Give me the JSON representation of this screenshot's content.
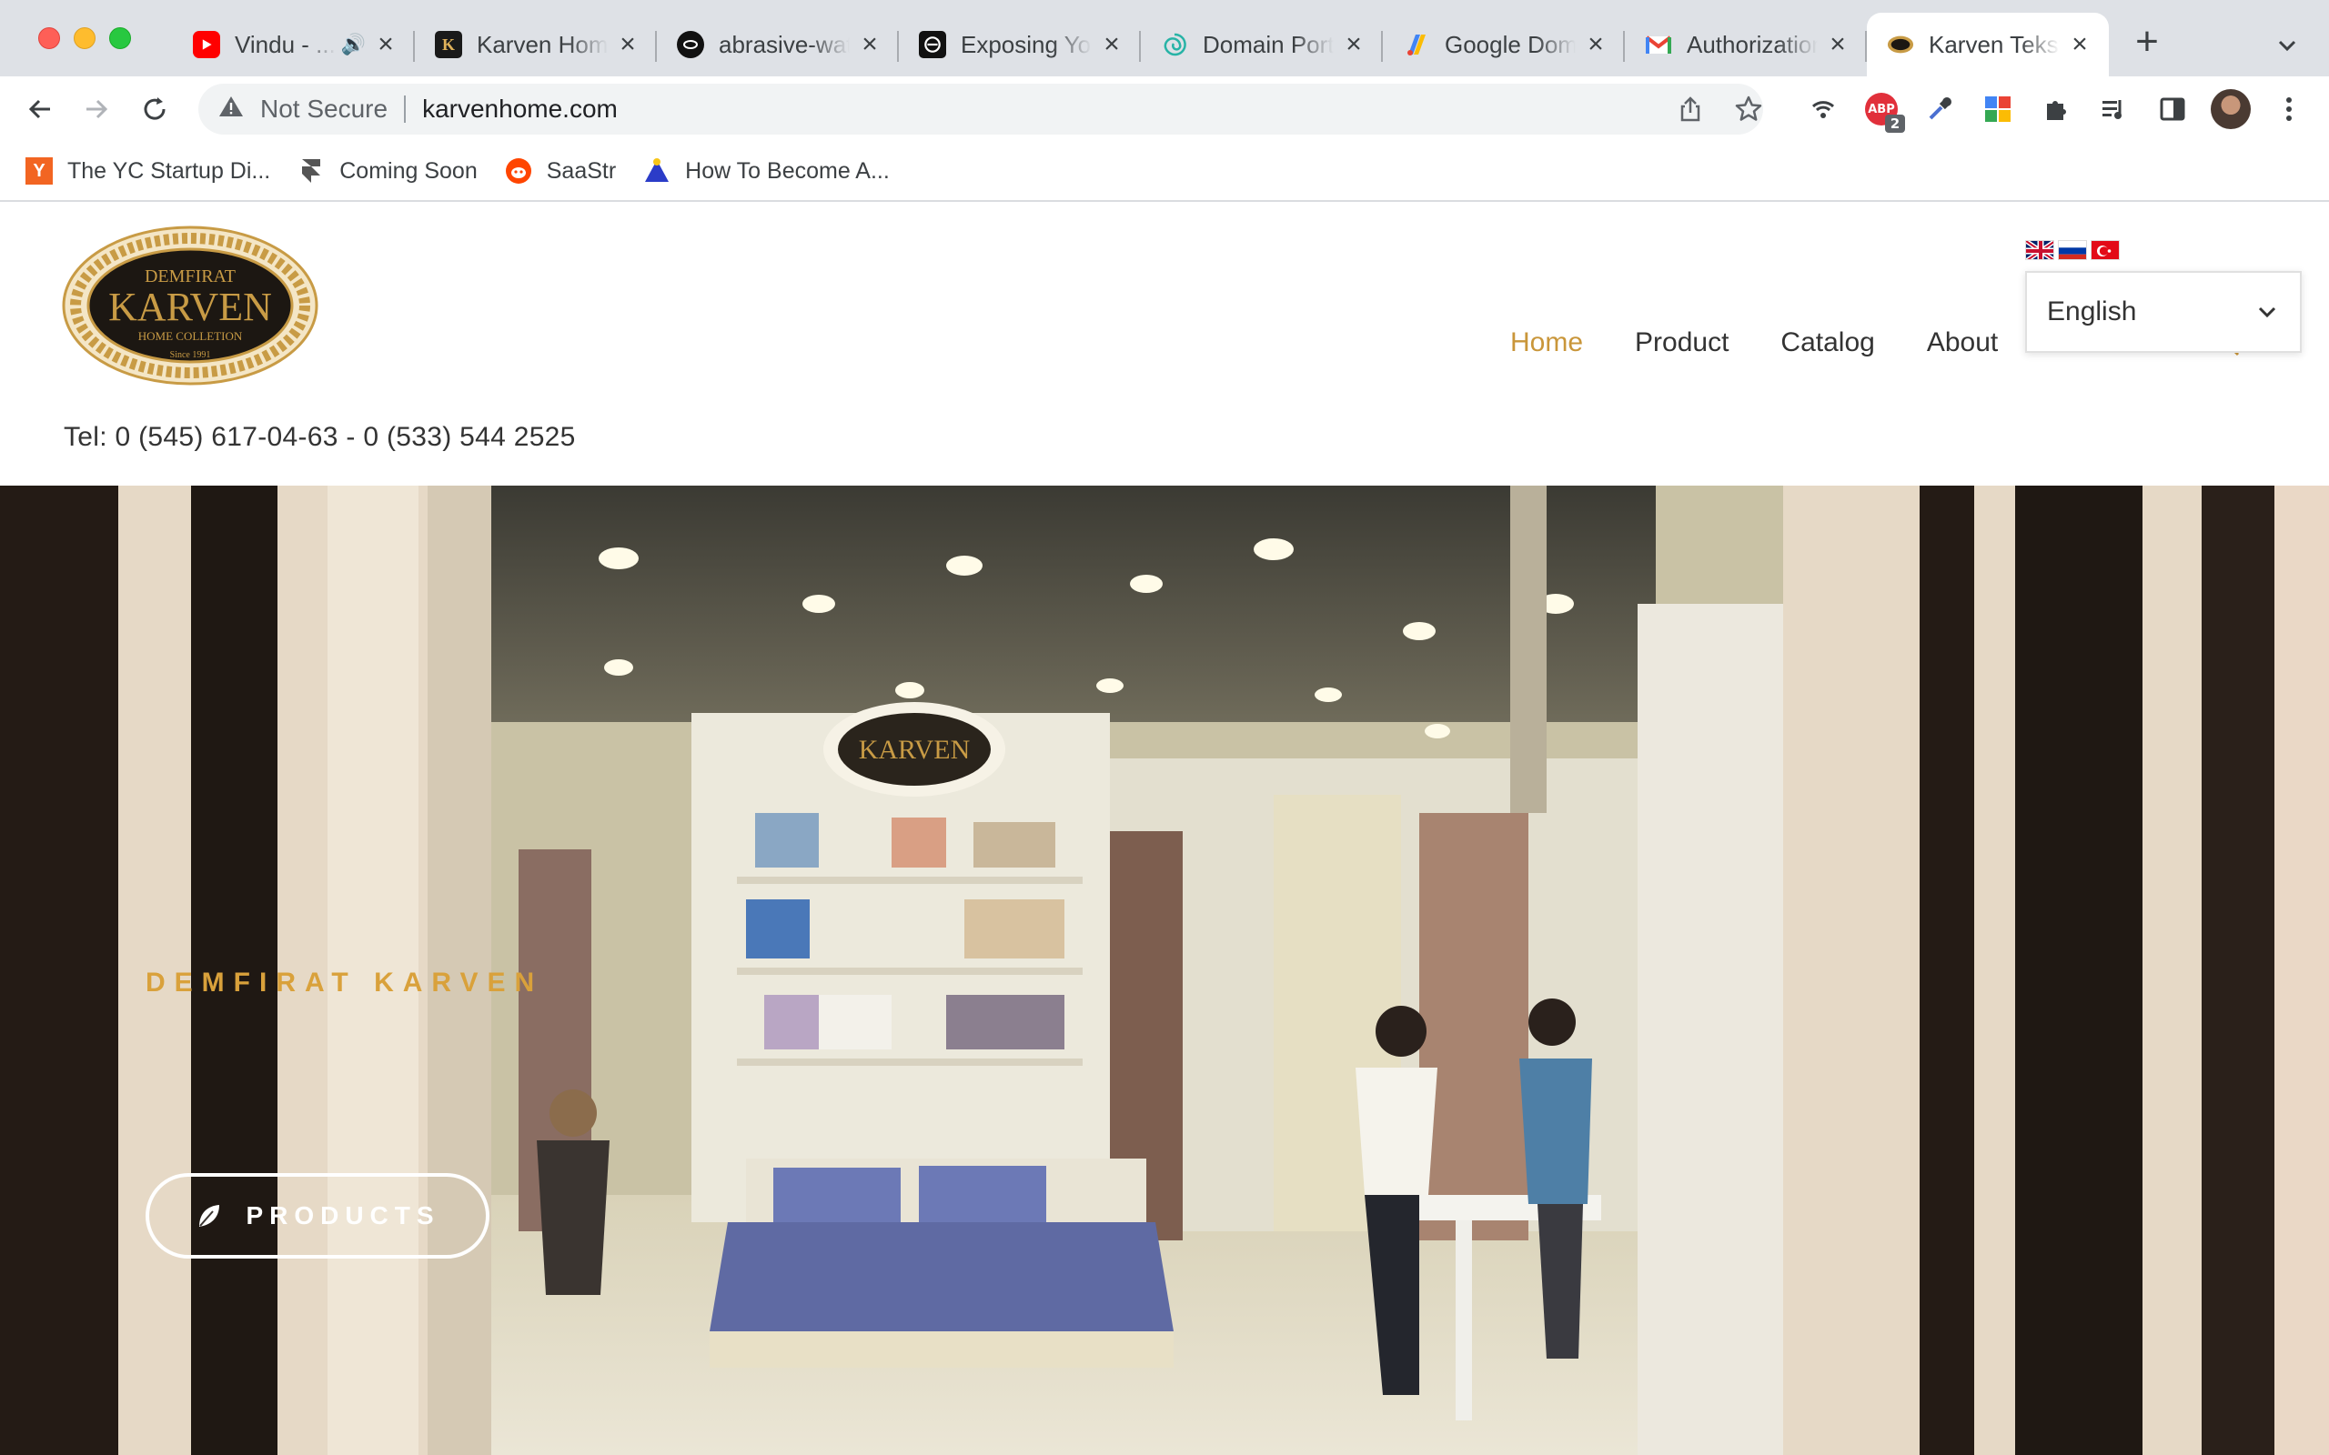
{
  "browser": {
    "tabs": [
      {
        "title": "Vindu - ...",
        "favicon": "youtube-icon",
        "has_audio": true
      },
      {
        "title": "Karven Home",
        "favicon": "karven-k-icon"
      },
      {
        "title": "abrasive-water",
        "favicon": "site-dark-icon"
      },
      {
        "title": "Exposing Your",
        "favicon": "site-dark-icon"
      },
      {
        "title": "Domain Portfolio",
        "favicon": "spiral-icon"
      },
      {
        "title": "Google Domains",
        "favicon": "google-domains-icon"
      },
      {
        "title": "Authorization",
        "favicon": "gmail-icon"
      },
      {
        "title": "Karven Tekstil",
        "favicon": "karven-logo-icon",
        "active": true
      }
    ],
    "omnibox": {
      "security_label": "Not Secure",
      "url": "karvenhome.com"
    },
    "extensions": {
      "adblock_badge": "2",
      "adblock_label": "ABP"
    },
    "bookmarks": [
      {
        "label": "The YC Startup Di...",
        "icon": "yc-icon",
        "color": "#f26522"
      },
      {
        "label": "Coming Soon",
        "icon": "framer-icon",
        "color": "#555555"
      },
      {
        "label": "SaaStr",
        "icon": "reddit-icon",
        "color": "#ff4500"
      },
      {
        "label": "How To Become A...",
        "icon": "triangle-icon",
        "color": "#2b3cc8"
      }
    ]
  },
  "site": {
    "logo": {
      "top": "DEMFIRAT",
      "main": "KARVEN",
      "sub": "HOME COLLETION",
      "since": "Since 1991"
    },
    "phone": "Tel: 0 (545) 617-04-63 - 0 (533) 544 2525",
    "nav": [
      "Home",
      "Product",
      "Catalog",
      "About"
    ],
    "nav_active": "Home",
    "language": {
      "selected": "English",
      "flags": [
        "uk-flag-icon",
        "russia-flag-icon",
        "turkey-flag-icon"
      ]
    },
    "hero": {
      "kicker": "DEMFIRAT KARVEN",
      "button_label": "PRODUCTS",
      "booth_sign": "KARVEN"
    },
    "colors": {
      "accent": "#c9963a",
      "logo_gold": "#c89b45",
      "logo_dark": "#1c1712"
    }
  }
}
